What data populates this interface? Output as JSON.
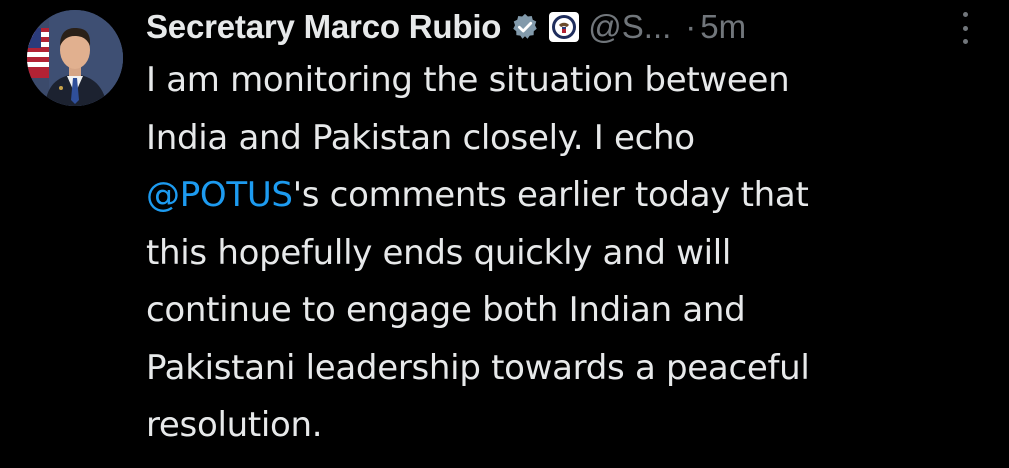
{
  "tweet": {
    "display_name": "Secretary Marco Rubio",
    "handle": "@S...",
    "separator": "·",
    "time": "5m",
    "verified_badge_color": "#829aab",
    "mention_color": "#1d9bf0",
    "body_lines": [
      {
        "text": "I am monitoring the situation between"
      },
      {
        "text": "India and Pakistan closely. I echo"
      },
      {
        "mention": "@POTUS",
        "text": "'s comments earlier today that"
      },
      {
        "text": "this hopefully ends quickly and will"
      },
      {
        "text": "continue to engage both Indian and"
      },
      {
        "text": "Pakistani leadership towards a peaceful"
      },
      {
        "text": "resolution."
      }
    ]
  }
}
